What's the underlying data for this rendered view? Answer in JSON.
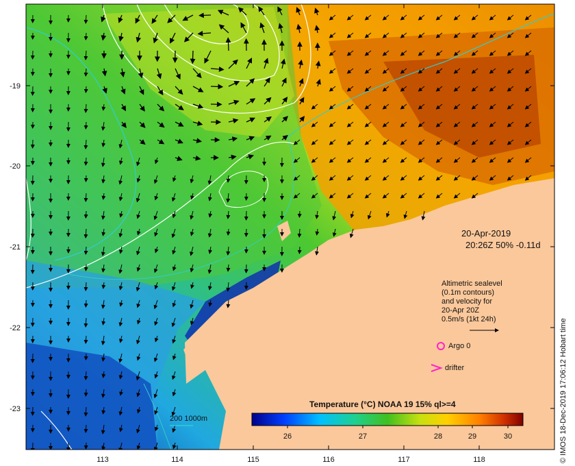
{
  "date_stamp": {
    "line1": "20-Apr-2019",
    "line2": "20:26Z  50% -0.11d"
  },
  "legend_note": {
    "lines": [
      "Altimetric sealevel",
      "(0.1m contours)",
      "and velocity for",
      "20-Apr 20Z",
      "0.5m/s (1kt 24h)"
    ]
  },
  "markers": {
    "argo": "Argo 0",
    "drifter": "drifter"
  },
  "isobath_legend": {
    "label": "200  1000m"
  },
  "colorbar": {
    "title": "Temperature (°C) NOAA 19 15% ql>=4",
    "ticks": [
      "26",
      "27",
      "28",
      "29",
      "30"
    ]
  },
  "axes": {
    "x_ticks": [
      "113",
      "114",
      "115",
      "116",
      "117",
      "118"
    ],
    "y_ticks": [
      "-19",
      "-20",
      "-21",
      "-22",
      "-23"
    ]
  },
  "credit": "© IMOS 18-Dec-2019 17:06:12 Hobart time",
  "colors": {
    "land": "#fbc89b",
    "isobath": "#33cccc",
    "contour": "#ffffff",
    "argo": "#ff22cc",
    "drifter": "#ff22cc"
  }
}
